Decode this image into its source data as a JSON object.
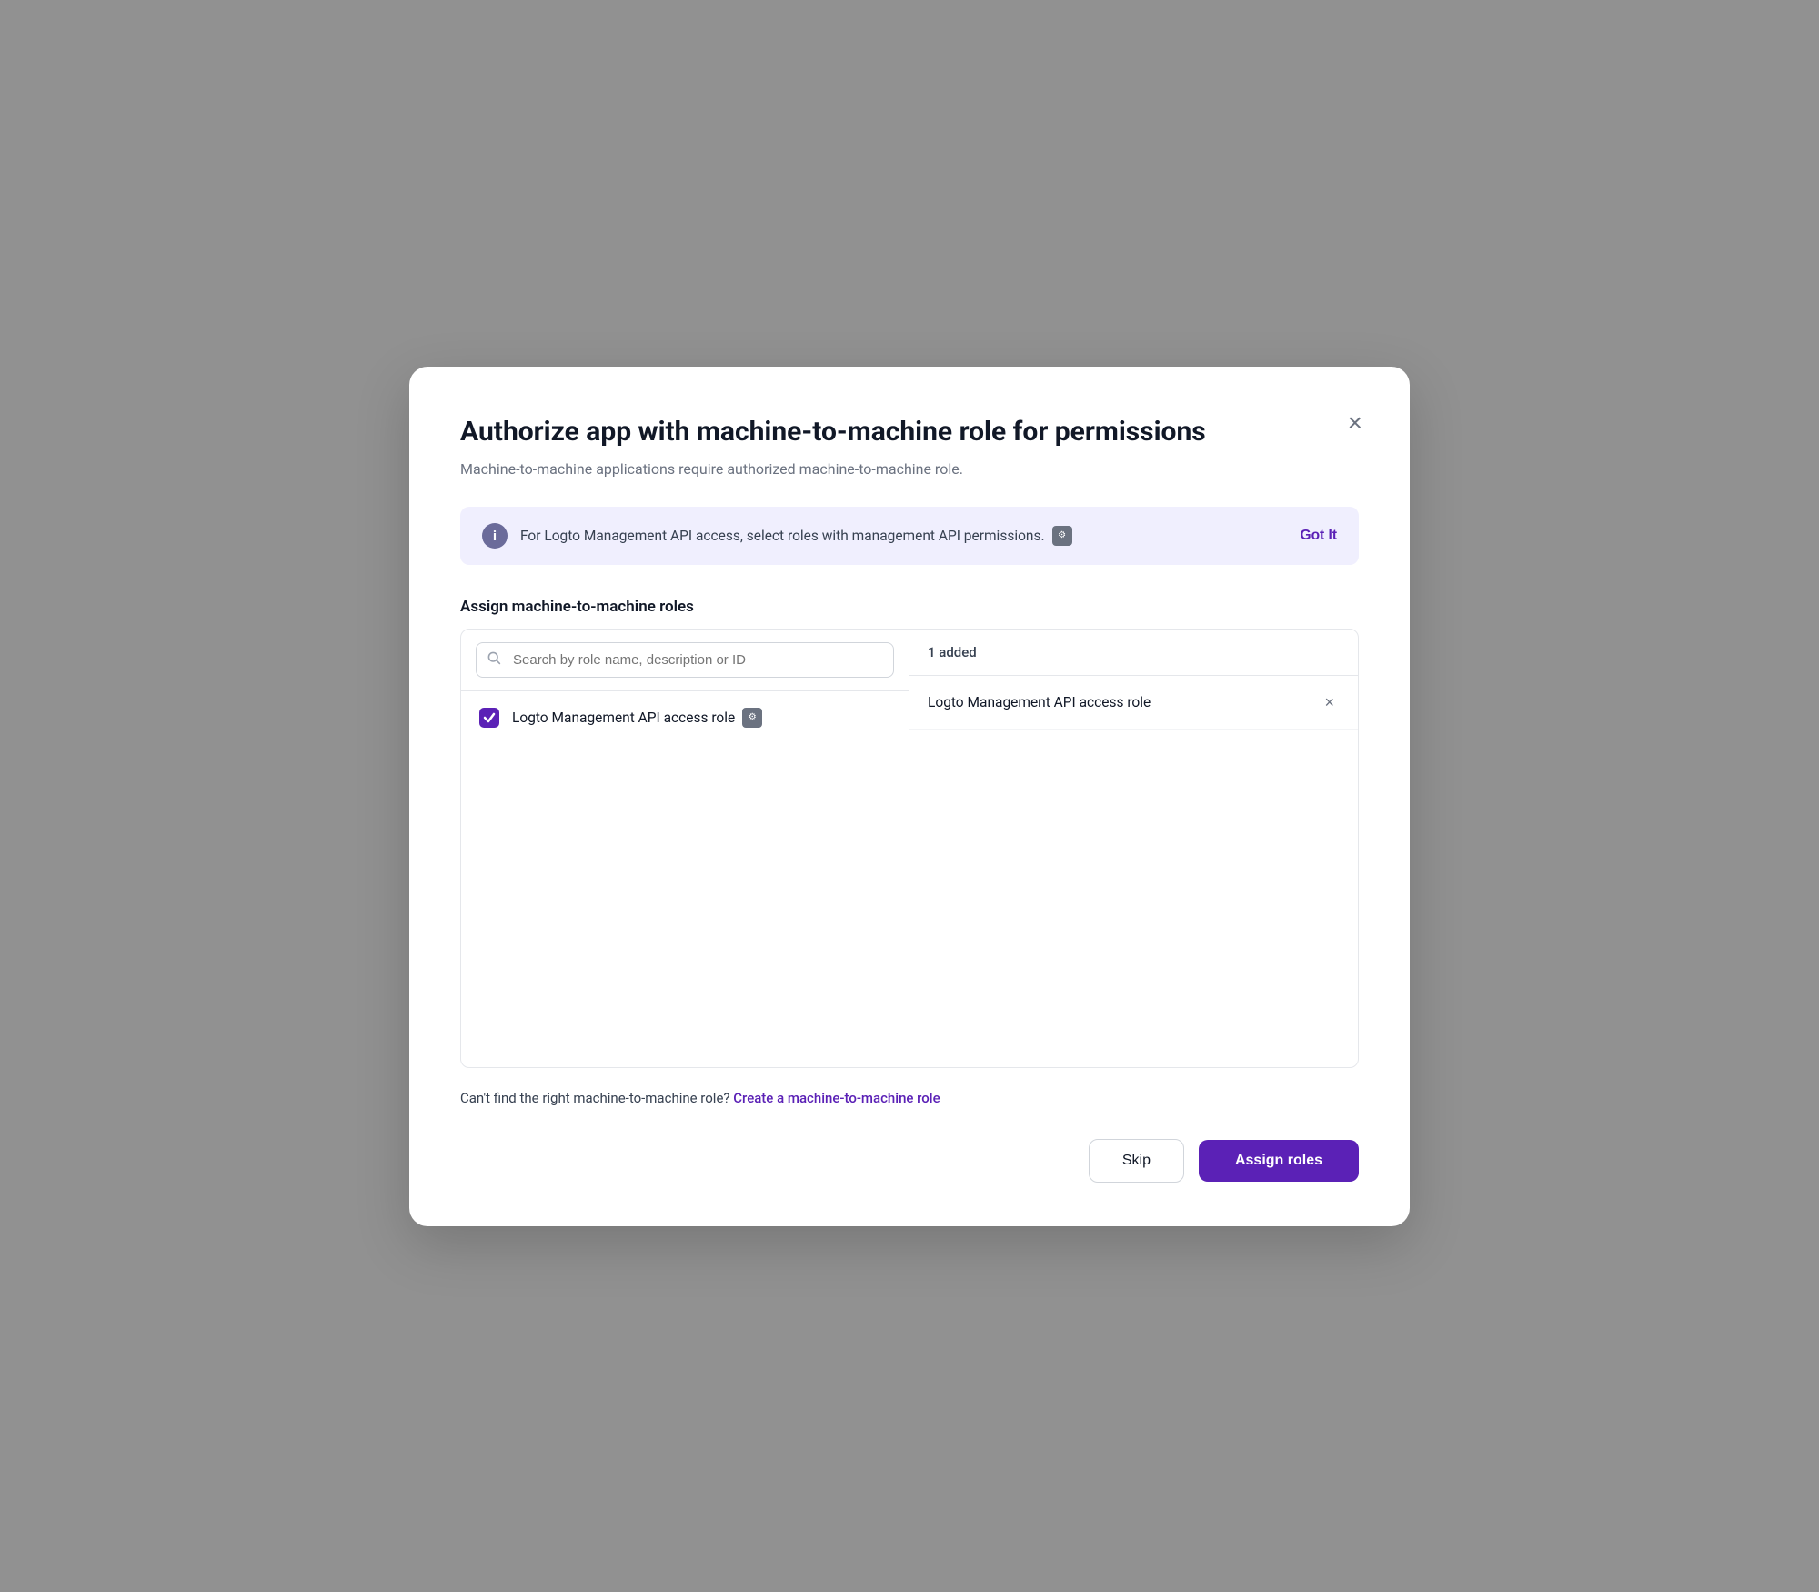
{
  "modal": {
    "title": "Authorize app with machine-to-machine role for permissions",
    "subtitle": "Machine-to-machine applications require authorized machine-to-machine role.",
    "close_label": "×"
  },
  "info_banner": {
    "icon_label": "i",
    "text": "For Logto Management API access, select roles with management API permissions.",
    "api_icon_label": "🔑",
    "got_it_label": "Got It"
  },
  "section": {
    "title": "Assign machine-to-machine roles"
  },
  "search": {
    "placeholder": "Search by role name, description or ID"
  },
  "table": {
    "right_header": "1 added",
    "left_role": {
      "name": "Logto Management API access role",
      "tag": "🔑"
    },
    "right_role": {
      "name": "Logto Management API access role"
    }
  },
  "footer": {
    "text": "Can't find the right machine-to-machine role?",
    "link_label": "Create a machine-to-machine role"
  },
  "buttons": {
    "skip_label": "Skip",
    "assign_label": "Assign roles"
  }
}
